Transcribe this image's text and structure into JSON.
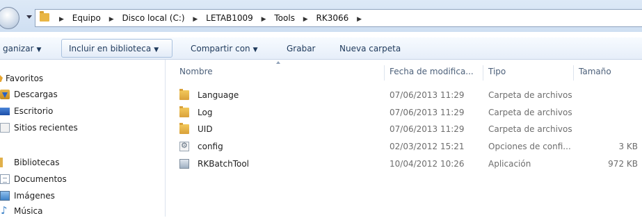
{
  "address": {
    "crumbs": [
      "Equipo",
      "Disco local (C:)",
      "LETAB1009",
      "Tools",
      "RK3066"
    ]
  },
  "toolbar": {
    "organize": "ganizar",
    "include": "Incluir en biblioteca",
    "share": "Compartir con",
    "burn": "Grabar",
    "new_folder": "Nueva carpeta"
  },
  "nav": {
    "favorites": "Favoritos",
    "downloads": "Descargas",
    "desktop": "Escritorio",
    "recent": "Sitios recientes",
    "libraries": "Bibliotecas",
    "documents": "Documentos",
    "images": "Imágenes",
    "music": "Música"
  },
  "columns": {
    "name": "Nombre",
    "date": "Fecha de modifica...",
    "type": "Tipo",
    "size": "Tamaño"
  },
  "files": [
    {
      "name": "Language",
      "date": "07/06/2013 11:29",
      "type": "Carpeta de archivos",
      "size": "",
      "icon": "folder-icon"
    },
    {
      "name": "Log",
      "date": "07/06/2013 11:29",
      "type": "Carpeta de archivos",
      "size": "",
      "icon": "folder-icon"
    },
    {
      "name": "UID",
      "date": "07/06/2013 11:29",
      "type": "Carpeta de archivos",
      "size": "",
      "icon": "folder-icon"
    },
    {
      "name": "config",
      "date": "02/03/2012 15:21",
      "type": "Opciones de confi...",
      "size": "3 KB",
      "icon": "settings-file-icon"
    },
    {
      "name": "RKBatchTool",
      "date": "10/04/2012 10:26",
      "type": "Aplicación",
      "size": "972 KB",
      "icon": "application-icon"
    }
  ]
}
